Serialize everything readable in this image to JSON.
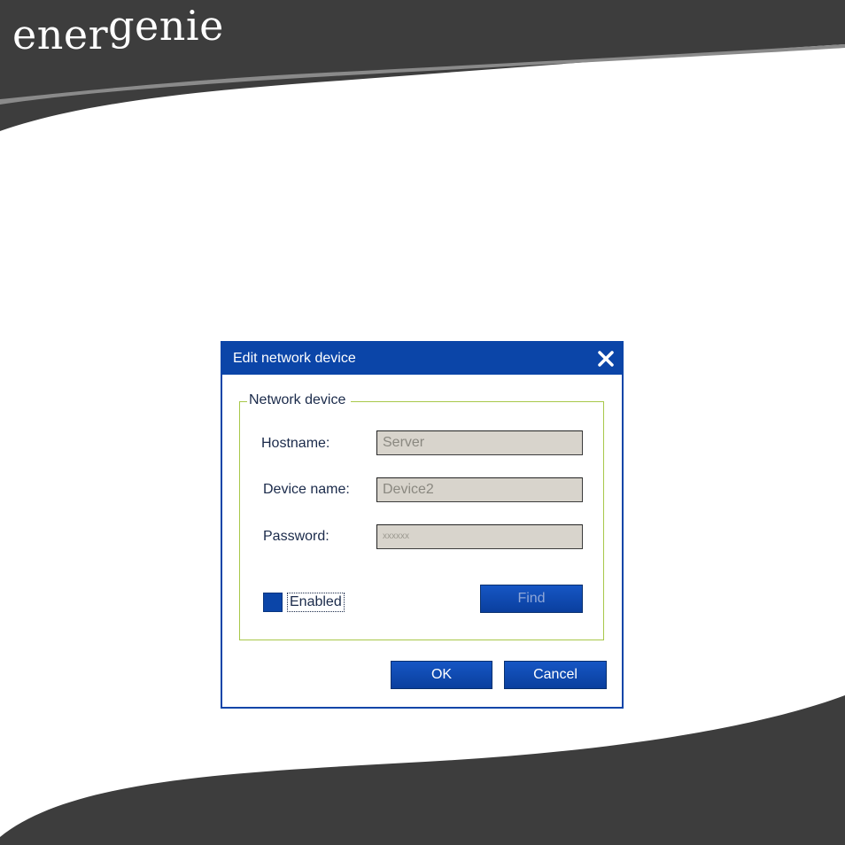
{
  "brand": {
    "logo_text_a": "ener",
    "logo_text_b": "genie"
  },
  "dialog": {
    "title": "Edit network device",
    "group_title": "Network device",
    "fields": [
      {
        "label": "Hostname:",
        "value": "Server"
      },
      {
        "label": "Device name:",
        "value": "Device2"
      },
      {
        "label": "Password:",
        "value": "xxxxxx"
      }
    ],
    "enabled_label": "Enabled",
    "find_label": "Find",
    "ok_label": "OK",
    "cancel_label": "Cancel"
  },
  "colors": {
    "accent": "#0b45a8",
    "group_border": "#a8c84a",
    "swoosh": "#3d3d3d"
  },
  "icons": {
    "close": "close-icon"
  }
}
